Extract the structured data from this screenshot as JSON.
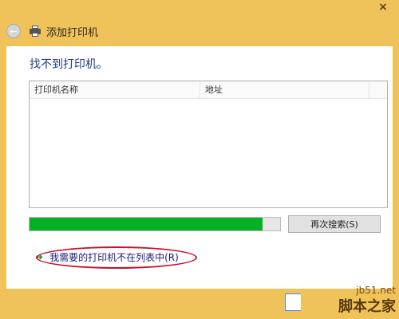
{
  "window": {
    "title": "添加打印机",
    "close_glyph": "×",
    "back_glyph": "←"
  },
  "content": {
    "heading": "找不到打印机。",
    "list": {
      "columns": [
        "打印机名称",
        "地址"
      ]
    },
    "progress": {
      "value": 0.93
    },
    "search_again_label": "再次搜索(S)",
    "not_listed_link": "我需要的打印机不在列表中(R)"
  },
  "watermark": {
    "line1": "jb51.net",
    "line2": "脚本之家"
  },
  "colors": {
    "title_bar": "#f0c35a",
    "progress_fill": "#06b025",
    "highlight_circle": "#c8102e"
  }
}
